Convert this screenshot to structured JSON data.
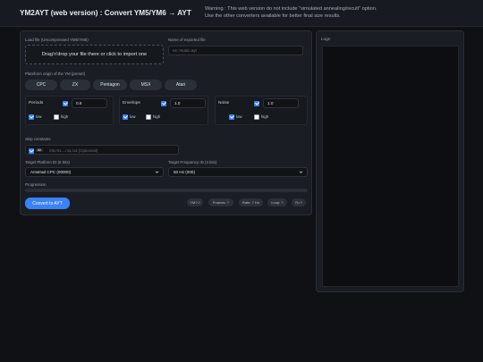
{
  "header": {
    "title": "YM2AYT (web version) : Convert YM5/YM6 → AYT",
    "warning_line1": "Warning : This web version do not include \"simulated annealing/recult\" option.",
    "warning_line2": "Use the other converters available for better final size results."
  },
  "load": {
    "label": "Load file (Uncompressed YM5/YM6)",
    "dropzone_text": "Drag'n'drop your file there or click to import one"
  },
  "export": {
    "label": "Name of exported file",
    "placeholder": "ex: music.ayt"
  },
  "platform": {
    "label": "Plateform origin of the YM (preset)",
    "buttons": [
      "CPC",
      "ZX",
      "Pentagon",
      "MSX",
      "Atari"
    ]
  },
  "groups": {
    "periods": {
      "label": "Periods",
      "checked": true,
      "value": "0.5",
      "low": "low",
      "high": "high"
    },
    "envelope": {
      "label": "Envelope",
      "checked": true,
      "value": "1.0",
      "low": "low",
      "high": "high"
    },
    "noise": {
      "label": "Noise",
      "checked": true,
      "value": "1.0",
      "low": "low",
      "high": "high"
    }
  },
  "skip": {
    "label": "Skip constants",
    "badge": "All",
    "placeholder": "r00,r01....r11,r12 (Optionnal)"
  },
  "target_platform": {
    "label": "Target Platform ID (5 bits)",
    "selected": "Amstrad CPC (00000)"
  },
  "target_frequency": {
    "label": "Target Frequency ID (3 bits)",
    "selected": "50 Hz (000)"
  },
  "progression": {
    "label": "Progression",
    "value": 0
  },
  "actions": {
    "convert": "Convert to AYT"
  },
  "stats": {
    "ym": "YM?:?",
    "frames": "Frames: ?",
    "rate": "Rate: ? Hz",
    "loop": "Loop: ?",
    "r": "R=?"
  },
  "logs": {
    "label": "Logs"
  },
  "colors": {
    "accent": "#3b82f6",
    "background": "#0f1115",
    "panel": "#1a1d23"
  }
}
